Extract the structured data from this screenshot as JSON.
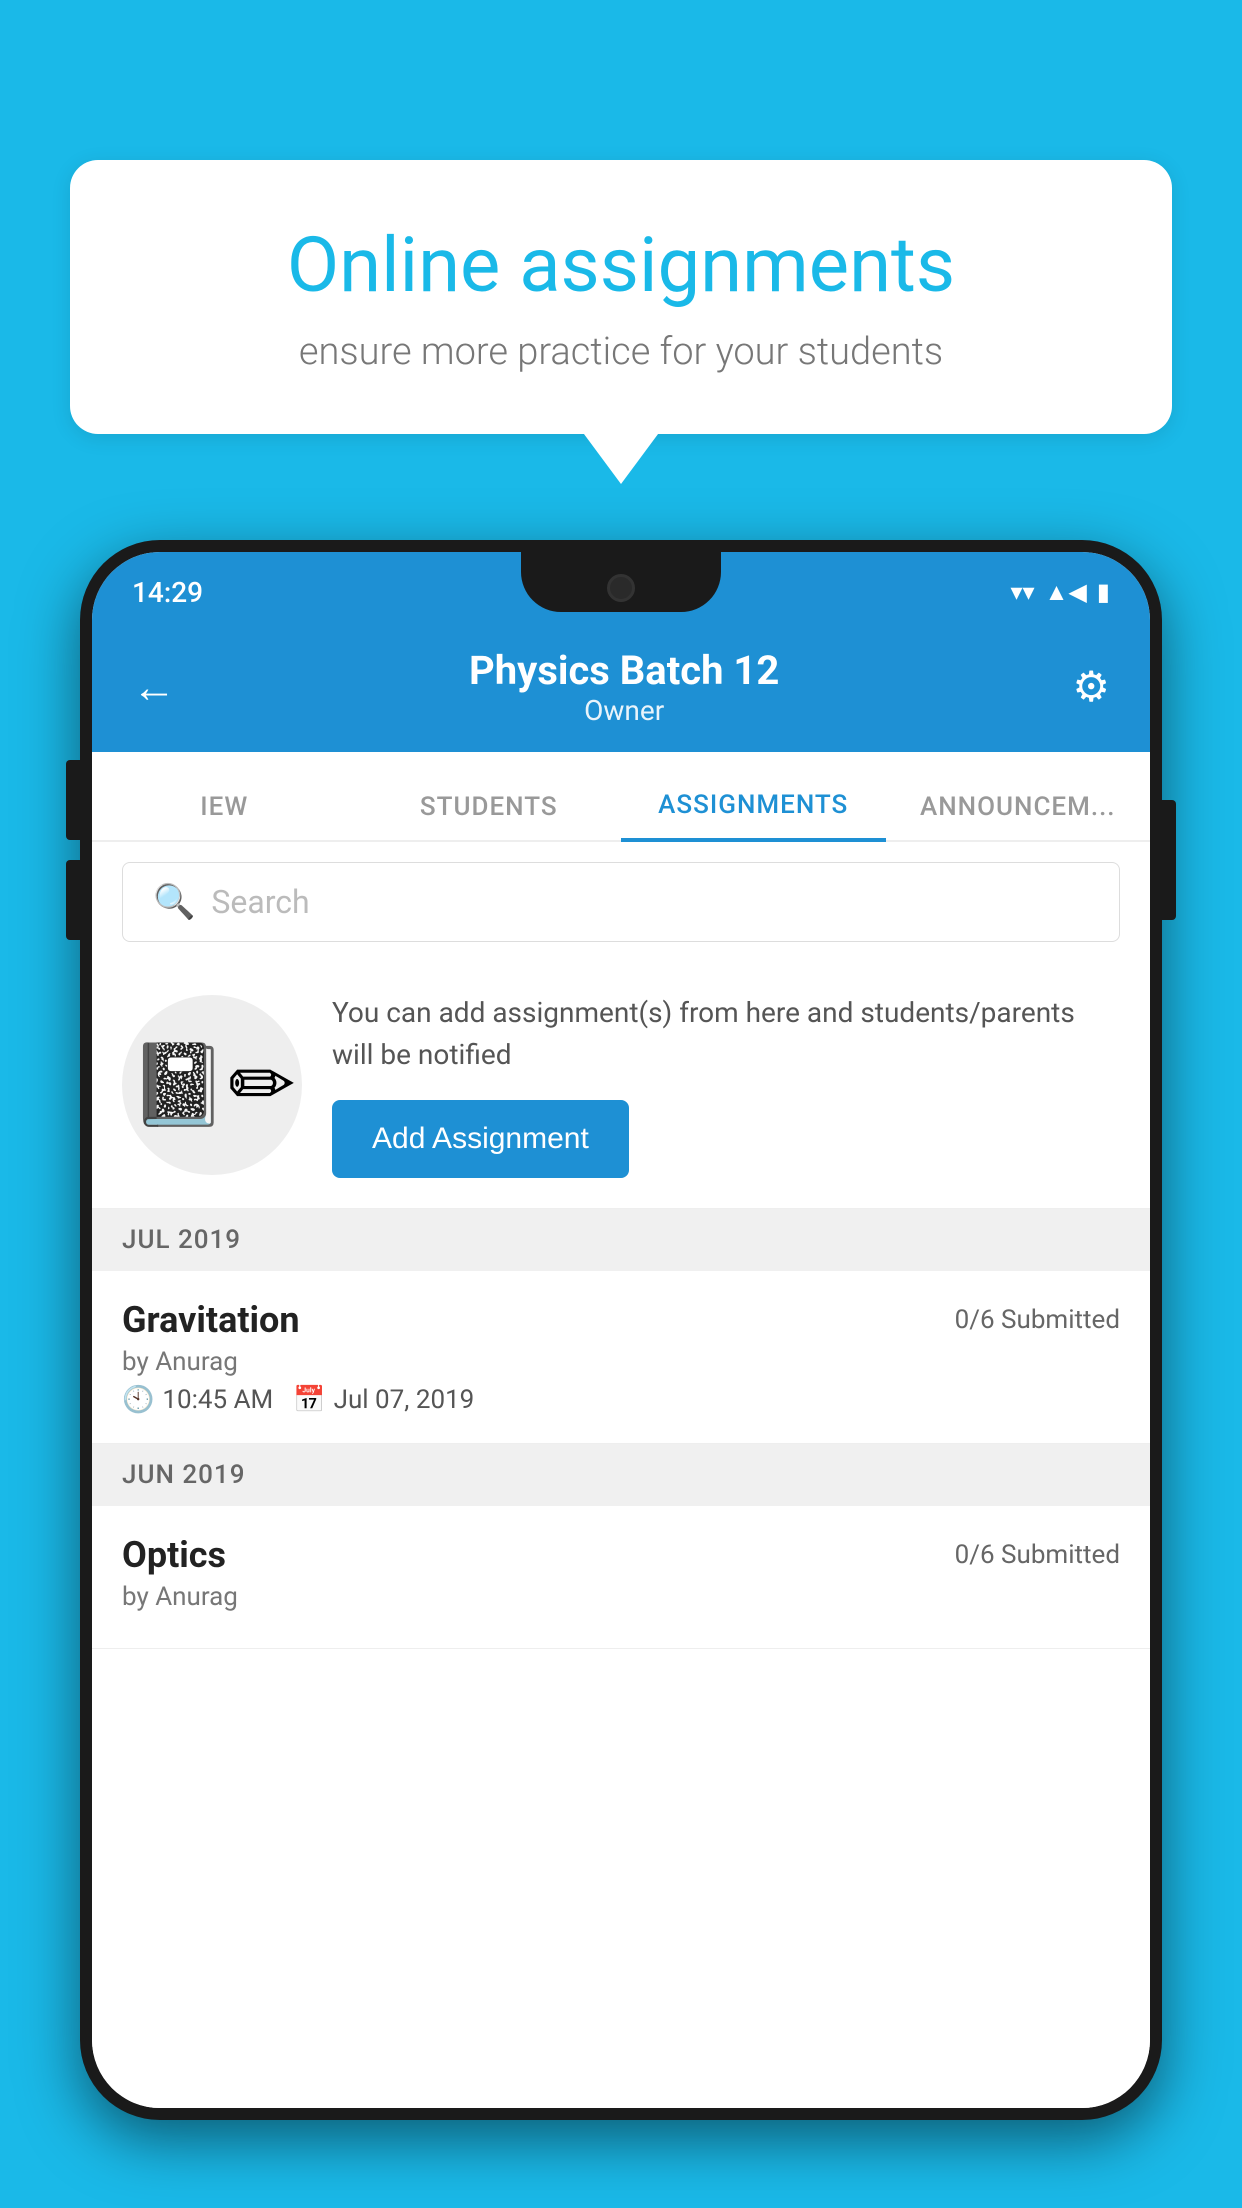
{
  "background_color": "#1ab9e8",
  "speech_bubble": {
    "title": "Online assignments",
    "subtitle": "ensure more practice for your students"
  },
  "status_bar": {
    "time": "14:29",
    "wifi": "▼",
    "signal": "▲",
    "battery": "▮"
  },
  "header": {
    "title": "Physics Batch 12",
    "subtitle": "Owner",
    "back_label": "←",
    "settings_label": "⚙"
  },
  "tabs": [
    {
      "label": "IEW",
      "active": false
    },
    {
      "label": "STUDENTS",
      "active": false
    },
    {
      "label": "ASSIGNMENTS",
      "active": true
    },
    {
      "label": "ANNOUNCEM...",
      "active": false
    }
  ],
  "search": {
    "placeholder": "Search"
  },
  "promo": {
    "text": "You can add assignment(s) from here and students/parents will be notified",
    "button_label": "Add Assignment"
  },
  "sections": [
    {
      "header": "JUL 2019",
      "assignments": [
        {
          "name": "Gravitation",
          "status": "0/6 Submitted",
          "author": "by Anurag",
          "time": "10:45 AM",
          "date": "Jul 07, 2019"
        }
      ]
    },
    {
      "header": "JUN 2019",
      "assignments": [
        {
          "name": "Optics",
          "status": "0/6 Submitted",
          "author": "by Anurag",
          "time": "",
          "date": ""
        }
      ]
    }
  ]
}
